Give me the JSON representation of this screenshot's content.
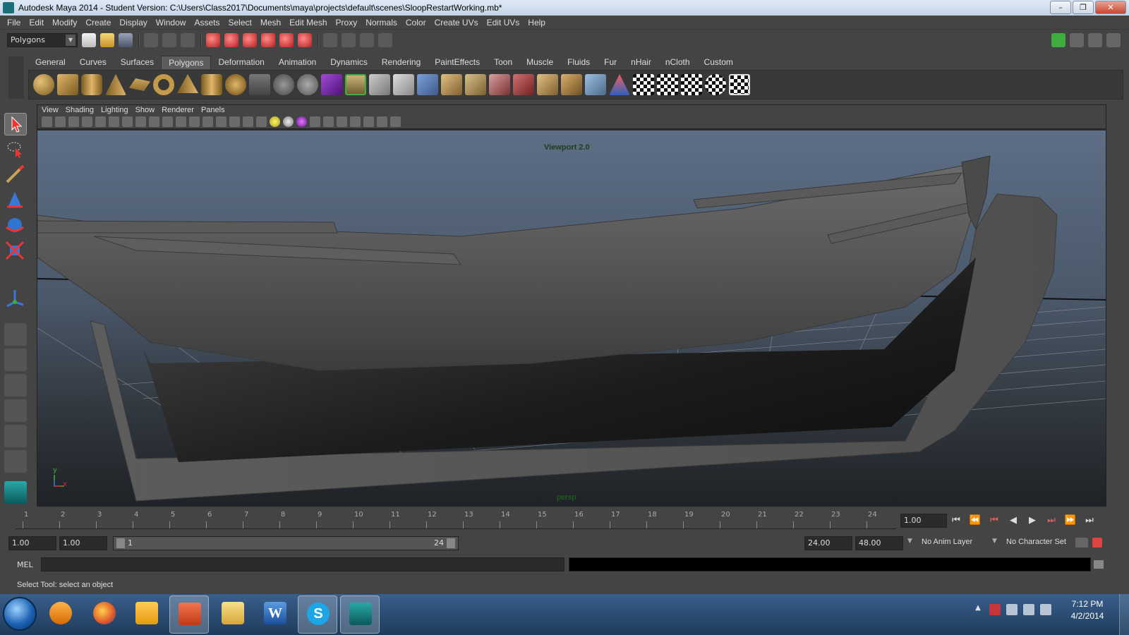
{
  "window": {
    "title": "Autodesk Maya 2014 - Student Version: C:\\Users\\Class2017\\Documents\\maya\\projects\\default\\scenes\\SloopRestartWorking.mb*",
    "minimize": "–",
    "maximize": "❐",
    "close": "✕"
  },
  "menubar": [
    "File",
    "Edit",
    "Modify",
    "Create",
    "Display",
    "Window",
    "Assets",
    "Select",
    "Mesh",
    "Edit Mesh",
    "Proxy",
    "Normals",
    "Color",
    "Create UVs",
    "Edit UVs",
    "Help"
  ],
  "statusline": {
    "mode": "Polygons"
  },
  "shelf": {
    "tabs": [
      "General",
      "Curves",
      "Surfaces",
      "Polygons",
      "Deformation",
      "Animation",
      "Dynamics",
      "Rendering",
      "PaintEffects",
      "Toon",
      "Muscle",
      "Fluids",
      "Fur",
      "nHair",
      "nCloth",
      "Custom"
    ],
    "active_tab": "Polygons"
  },
  "panel": {
    "menus": [
      "View",
      "Shading",
      "Lighting",
      "Show",
      "Renderer",
      "Panels"
    ],
    "renderer_label": "Viewport 2.0",
    "camera": "persp",
    "axis_y": "y",
    "axis_x": "x"
  },
  "timeslider": {
    "ticks": [
      "1",
      "2",
      "3",
      "4",
      "5",
      "6",
      "7",
      "8",
      "9",
      "10",
      "11",
      "12",
      "13",
      "14",
      "15",
      "16",
      "17",
      "18",
      "19",
      "20",
      "21",
      "22",
      "23",
      "24"
    ],
    "current_frame": "1.00",
    "playback_buttons": [
      "⏮",
      "⏪",
      "⏭",
      "◀",
      "▶",
      "⏭",
      "▶▶",
      "⏭"
    ]
  },
  "range": {
    "start_time": "1.00",
    "playback_start": "1.00",
    "range_low": "1",
    "range_high": "24",
    "playback_end": "24.00",
    "end_time": "48.00",
    "anim_layer": "No Anim Layer",
    "character_set": "No Character Set"
  },
  "commandline": {
    "label": "MEL"
  },
  "helpline": {
    "text": "Select Tool: select an object"
  },
  "taskbar": {
    "clock_time": "7:12 PM",
    "clock_date": "4/2/2014",
    "word_letter": "W",
    "skype_letter": "S"
  },
  "colors": {
    "maya_bg": "#444444",
    "viewport_top": "#5d6e86",
    "viewport_bottom": "#1f2226",
    "hull": "#5a5a5a",
    "taskbar": "#2a4a70"
  }
}
